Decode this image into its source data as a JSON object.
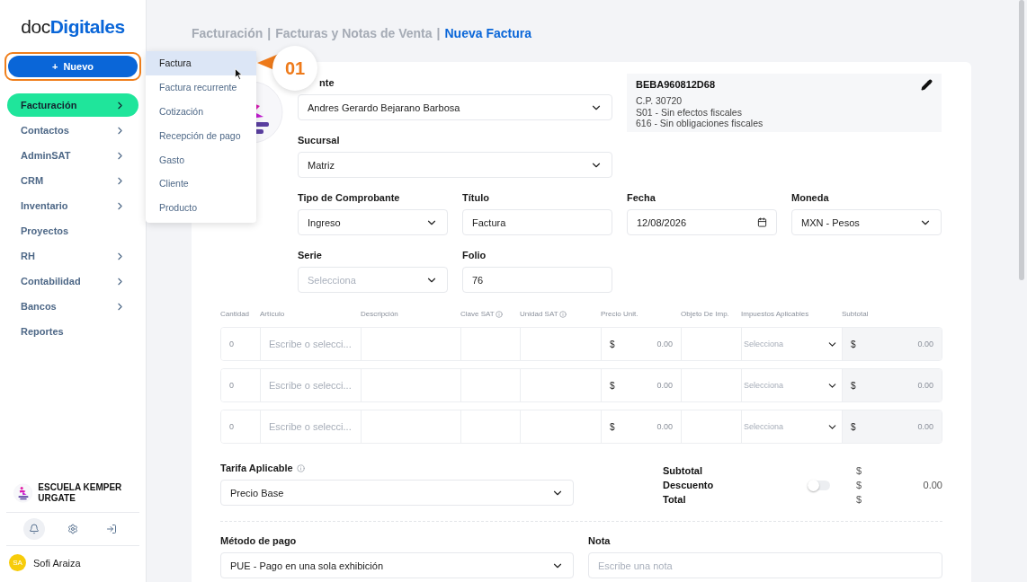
{
  "brand": {
    "prefix": "doc",
    "name": "Digitales"
  },
  "new_button": {
    "icon": "+",
    "label": "Nuevo",
    "highlighted": true
  },
  "sidebar": {
    "items": [
      {
        "label": "Facturación",
        "selected": true,
        "has_children": true
      },
      {
        "label": "Contactos",
        "selected": false,
        "has_children": true
      },
      {
        "label": "AdminSAT",
        "selected": false,
        "has_children": true
      },
      {
        "label": "CRM",
        "selected": false,
        "has_children": true
      },
      {
        "label": "Inventario",
        "selected": false,
        "has_children": true
      },
      {
        "label": "Proyectos",
        "selected": false,
        "has_children": false
      },
      {
        "label": "RH",
        "selected": false,
        "has_children": true
      },
      {
        "label": "Contabilidad",
        "selected": false,
        "has_children": true
      },
      {
        "label": "Bancos",
        "selected": false,
        "has_children": true
      },
      {
        "label": "Reportes",
        "selected": false,
        "has_children": false
      }
    ]
  },
  "company": {
    "name": "ESCUELA KEMPER URGATE"
  },
  "footer_actions": [
    {
      "kind": "bell",
      "selected": true
    },
    {
      "kind": "settings",
      "selected": false
    },
    {
      "kind": "logout",
      "selected": false
    }
  ],
  "user": {
    "initials": "SA",
    "name": "Sofi Araiza"
  },
  "new_menu": {
    "items": [
      {
        "label": "Factura",
        "selected": true
      },
      {
        "label": "Factura recurrente",
        "selected": false
      },
      {
        "label": "Cotización",
        "selected": false
      },
      {
        "label": "Recepción de pago",
        "selected": false
      },
      {
        "label": "Gasto",
        "selected": false
      },
      {
        "label": "Cliente",
        "selected": false
      },
      {
        "label": "Producto",
        "selected": false
      }
    ]
  },
  "callout": {
    "label": "01"
  },
  "breadcrumb": {
    "separator": "|",
    "items": [
      {
        "label": "Facturación",
        "current": false
      },
      {
        "label": "Facturas y Notas de Venta",
        "current": false
      },
      {
        "label": "Nueva Factura",
        "current": true
      }
    ]
  },
  "client_info": {
    "rfc": "BEBA960812D68",
    "lines": [
      "C.P. 30720",
      "S01 - Sin efectos fiscales",
      "616 - Sin obligaciones fiscales"
    ]
  },
  "fields": [
    {
      "label": "nte",
      "kind": "select",
      "value": "Andres Gerardo Bejarano Barbosa"
    },
    {
      "label": "Sucursal",
      "kind": "select",
      "value": "Matriz"
    },
    {
      "label": "Tipo de Comprobante",
      "kind": "select",
      "value": "Ingreso"
    },
    {
      "label": "Título",
      "kind": "text",
      "value": "Factura"
    },
    {
      "label": "Fecha",
      "kind": "date",
      "value": "12/08/2026"
    },
    {
      "label": "Moneda",
      "kind": "select",
      "value": "MXN - Pesos"
    },
    {
      "label": "Serie",
      "kind": "select",
      "placeholder": "Selecciona"
    },
    {
      "label": "Folio",
      "kind": "text",
      "value": "76"
    }
  ],
  "items_table": {
    "columns": [
      {
        "label": "Cantidad",
        "info": false
      },
      {
        "label": "Artículo",
        "info": false
      },
      {
        "label": "Descripción",
        "info": false
      },
      {
        "label": "Clave SAT",
        "info": true
      },
      {
        "label": "Unidad SAT",
        "info": true
      },
      {
        "label": "Precio Unit.",
        "info": false
      },
      {
        "label": "Objeto De Imp.",
        "info": false
      },
      {
        "label": "Impuestos Aplicables",
        "info": false
      },
      {
        "label": "Subtotal",
        "info": false
      }
    ],
    "rows": [
      {
        "quantity": "0",
        "article_placeholder": "Escribe o selecci...",
        "price_currency": "$",
        "price": "0.00",
        "tax_placeholder": "Selecciona",
        "subtotal_currency": "$",
        "subtotal": "0.00"
      },
      {
        "quantity": "0",
        "article_placeholder": "Escribe o selecci...",
        "price_currency": "$",
        "price": "0.00",
        "tax_placeholder": "Selecciona",
        "subtotal_currency": "$",
        "subtotal": "0.00"
      },
      {
        "quantity": "0",
        "article_placeholder": "Escribe o selecci...",
        "price_currency": "$",
        "price": "0.00",
        "tax_placeholder": "Selecciona",
        "subtotal_currency": "$",
        "subtotal": "0.00"
      }
    ]
  },
  "tarifa": {
    "label": "Tarifa Aplicable",
    "info": true,
    "value": "Precio Base"
  },
  "totals": [
    {
      "label": "Subtotal",
      "currency": "$"
    },
    {
      "label": "Descuento",
      "currency": "$",
      "value": "0.00",
      "toggle": {
        "on": false
      }
    },
    {
      "label": "Total",
      "currency": "$"
    }
  ],
  "payment_method": {
    "label": "Método de pago",
    "value": "PUE - Pago en una sola exhibición"
  },
  "note": {
    "label": "Nota",
    "placeholder": "Escribe una nota"
  }
}
